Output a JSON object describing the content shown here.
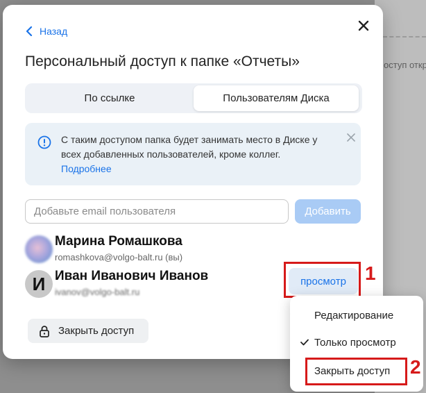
{
  "background": {
    "partial_text": "оступ откр"
  },
  "dialog": {
    "back_label": "Назад",
    "title": "Персональный доступ к папке «Отчеты»",
    "tabs": [
      {
        "label": "По ссылке",
        "active": false
      },
      {
        "label": "Пользователям Диска",
        "active": true
      }
    ],
    "info": {
      "text": "С таким доступом папка будет занимать место в Диске у всех добавленных пользователей, кроме коллег.",
      "link": "Подробнее",
      "icon": "info-circle-icon"
    },
    "email_input": {
      "placeholder": "Добавьте email пользователя",
      "value": ""
    },
    "add_button": "Добавить",
    "users": [
      {
        "name": "Марина Ромашкова",
        "email": "romashkova@volgo-balt.ru (вы)",
        "avatar": "blurred-photo"
      },
      {
        "name": "Иван Иванович Иванов",
        "email": "ivanov@volgo-balt.ru",
        "avatar_letter": "И",
        "role": "просмотр"
      }
    ],
    "close_access_button": "Закрыть доступ"
  },
  "dropdown": {
    "items": [
      {
        "label": "Редактирование",
        "checked": false
      },
      {
        "label": "Только просмотр",
        "checked": true
      },
      {
        "label": "Закрыть доступ",
        "checked": false
      }
    ]
  },
  "annotations": {
    "marker_1": "1",
    "marker_2": "2",
    "color": "#d61a1a"
  },
  "colors": {
    "accent": "#1a73e8",
    "info_bg": "#eaf1f7",
    "add_button_bg": "#a9cbf5"
  }
}
